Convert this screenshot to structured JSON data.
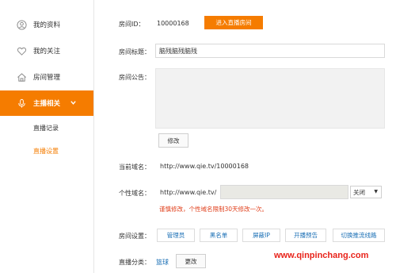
{
  "sidebar": {
    "items": [
      {
        "label": "我的资料",
        "icon": "user-icon"
      },
      {
        "label": "我的关注",
        "icon": "heart-icon"
      },
      {
        "label": "房间管理",
        "icon": "house-icon"
      },
      {
        "label": "主播相关",
        "icon": "microphone-icon"
      }
    ],
    "subitems": [
      {
        "label": "直播记录"
      },
      {
        "label": "直播设置"
      }
    ]
  },
  "room": {
    "id_label": "房间ID：",
    "id_value": "10000168",
    "enter_button": "进入直播房间",
    "title_label": "房间标题：",
    "title_value": "脑残脑残脑残",
    "notice_label": "房间公告：",
    "notice_value": "",
    "modify_button": "修改",
    "current_domain_label": "当前域名：",
    "current_domain_value": "http://www.qie.tv/10000168",
    "custom_domain_label": "个性域名：",
    "custom_domain_prefix": "http://www.qie.tv/",
    "custom_domain_value": "",
    "custom_domain_select": "关闭",
    "warning": "谨慎修改，个性域名限制30天修改一次。",
    "settings_label": "房间设置：",
    "settings_buttons": [
      "管理员",
      "黑名单",
      "屏蔽IP",
      "开播预告",
      "切换推流线路"
    ],
    "category_label": "直播分类：",
    "category_value": "篮球",
    "category_change_button": "更改"
  },
  "watermark": "www.qinpinchang.com",
  "colors": {
    "accent": "#f57c00",
    "link": "#1a6fb5",
    "warning": "#e03e1a",
    "watermark": "#e8231a"
  }
}
